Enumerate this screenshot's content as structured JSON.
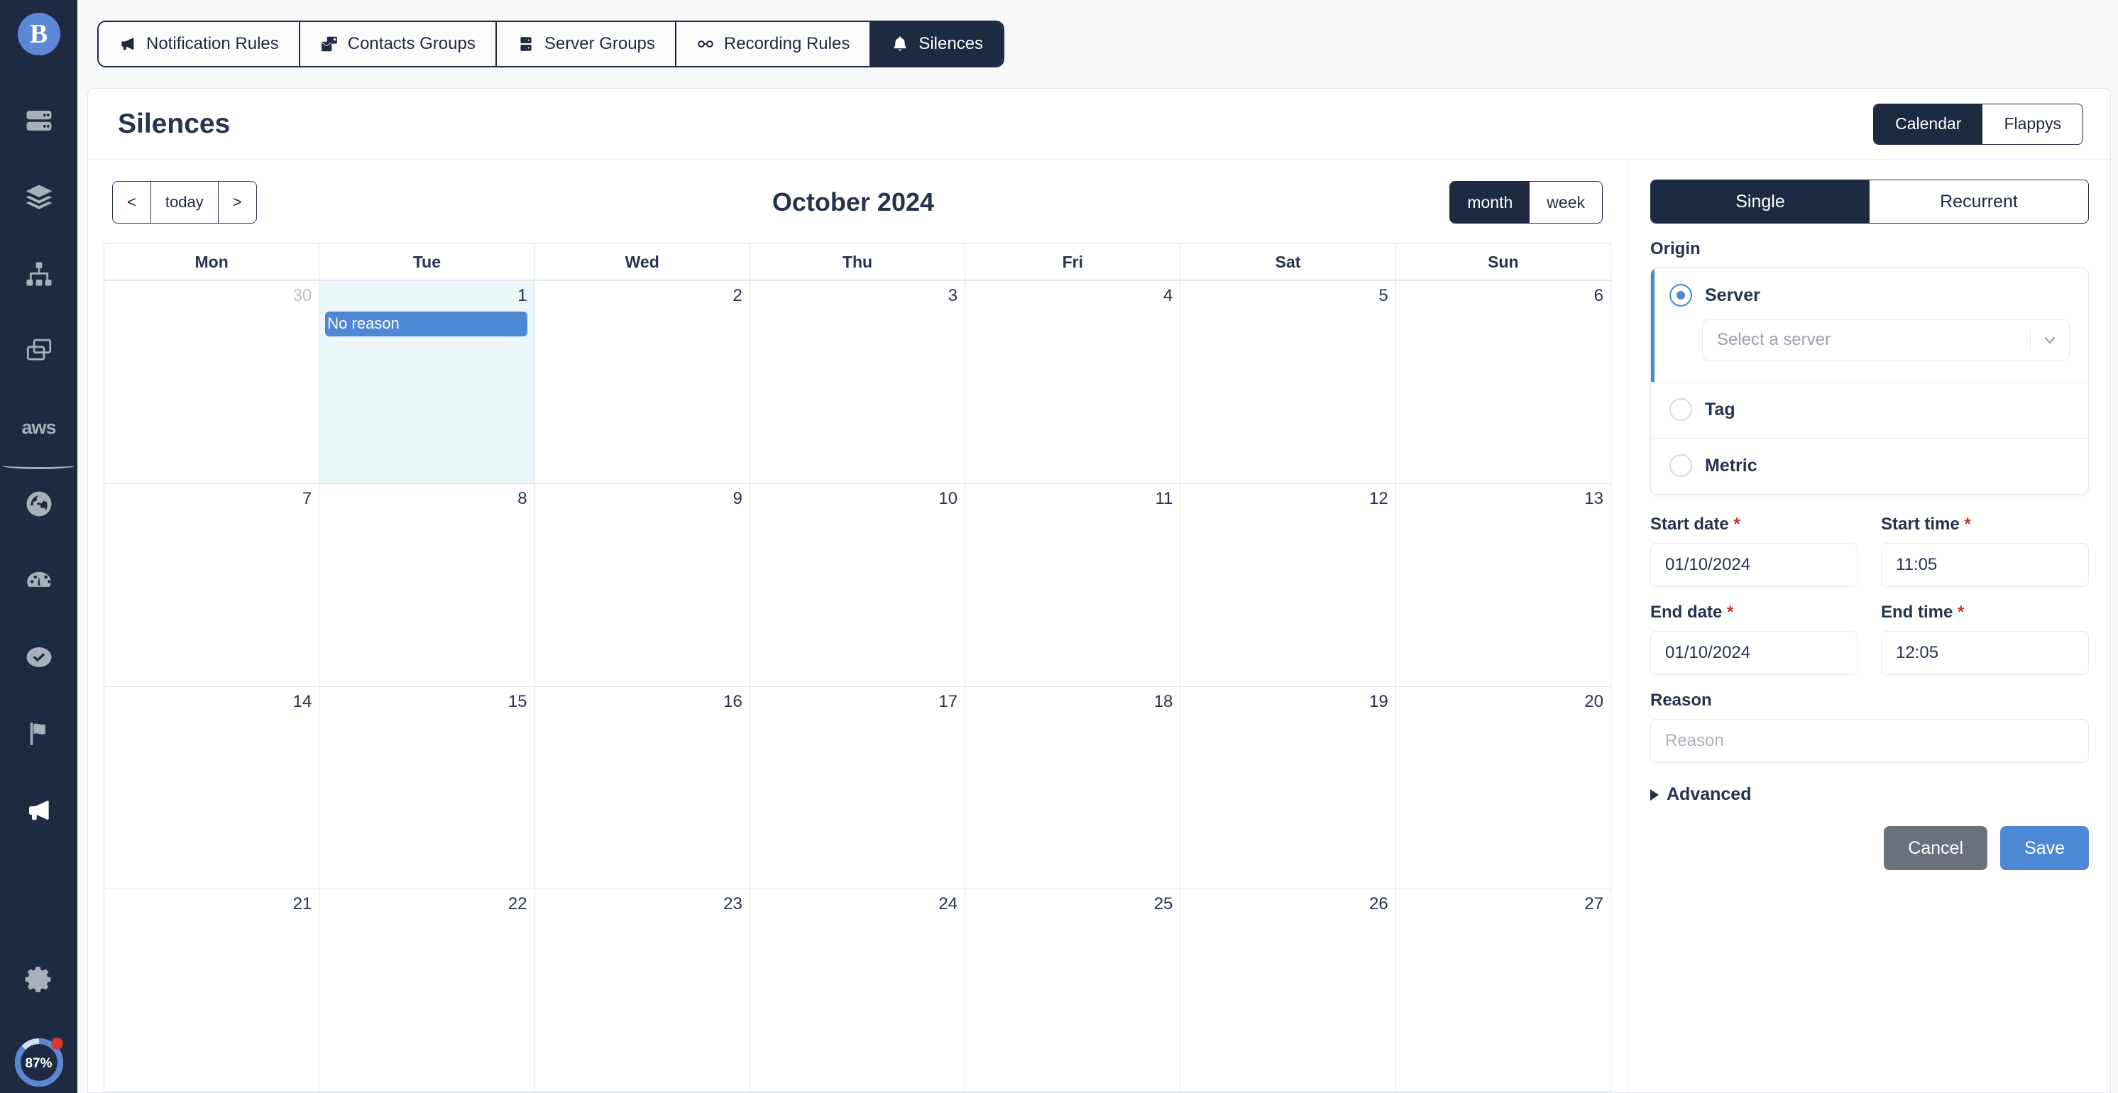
{
  "sidebar": {
    "brand_letter": "B",
    "items": [
      {
        "name": "servers-icon",
        "icon": "servers"
      },
      {
        "name": "layers-icon",
        "icon": "layers"
      },
      {
        "name": "sitemap-icon",
        "icon": "sitemap"
      },
      {
        "name": "clone-icon",
        "icon": "clone"
      },
      {
        "name": "aws-icon",
        "icon": "aws",
        "label": "aws"
      },
      {
        "name": "globe-icon",
        "icon": "globe"
      },
      {
        "name": "gauge-icon",
        "icon": "gauge"
      },
      {
        "name": "check-circle-icon",
        "icon": "check-circle"
      },
      {
        "name": "flag-icon",
        "icon": "flag"
      },
      {
        "name": "megaphone-icon",
        "icon": "megaphone",
        "active": true
      }
    ],
    "settings_icon": "gear",
    "quota_percent": "87%",
    "quota_value": 87
  },
  "tabs": [
    {
      "label": "Notification Rules",
      "icon": "bullhorn",
      "active": false
    },
    {
      "label": "Contacts Groups",
      "icon": "contacts",
      "active": false
    },
    {
      "label": "Server Groups",
      "icon": "server",
      "active": false
    },
    {
      "label": "Recording Rules",
      "icon": "glasses",
      "active": false
    },
    {
      "label": "Silences",
      "icon": "bell",
      "active": true
    }
  ],
  "page": {
    "title": "Silences",
    "view_toggle": [
      {
        "label": "Calendar",
        "active": true
      },
      {
        "label": "Flappys",
        "active": false
      }
    ]
  },
  "calendar": {
    "nav": {
      "prev": "<",
      "today": "today",
      "next": ">"
    },
    "title": "October 2024",
    "view_toggle": [
      {
        "label": "month",
        "active": true
      },
      {
        "label": "week",
        "active": false
      }
    ],
    "day_headers": [
      "Mon",
      "Tue",
      "Wed",
      "Thu",
      "Fri",
      "Sat",
      "Sun"
    ],
    "weeks": [
      [
        {
          "num": "30",
          "other": true
        },
        {
          "num": "1",
          "selected": true,
          "events": [
            "No reason"
          ]
        },
        {
          "num": "2"
        },
        {
          "num": "3"
        },
        {
          "num": "4"
        },
        {
          "num": "5"
        },
        {
          "num": "6"
        }
      ],
      [
        {
          "num": "7"
        },
        {
          "num": "8"
        },
        {
          "num": "9"
        },
        {
          "num": "10"
        },
        {
          "num": "11"
        },
        {
          "num": "12"
        },
        {
          "num": "13"
        }
      ],
      [
        {
          "num": "14"
        },
        {
          "num": "15"
        },
        {
          "num": "16"
        },
        {
          "num": "17"
        },
        {
          "num": "18"
        },
        {
          "num": "19"
        },
        {
          "num": "20"
        }
      ],
      [
        {
          "num": "21"
        },
        {
          "num": "22"
        },
        {
          "num": "23"
        },
        {
          "num": "24"
        },
        {
          "num": "25"
        },
        {
          "num": "26"
        },
        {
          "num": "27"
        }
      ]
    ]
  },
  "form": {
    "mode_toggle": [
      {
        "label": "Single",
        "active": true
      },
      {
        "label": "Recurrent",
        "active": false
      }
    ],
    "origin_label": "Origin",
    "origin_options": [
      {
        "label": "Server",
        "selected": true,
        "select_placeholder": "Select a server"
      },
      {
        "label": "Tag",
        "selected": false
      },
      {
        "label": "Metric",
        "selected": false
      }
    ],
    "start_date": {
      "label": "Start date",
      "required": "*",
      "value": "01/10/2024"
    },
    "start_time": {
      "label": "Start time",
      "required": "*",
      "value": "11:05"
    },
    "end_date": {
      "label": "End date",
      "required": "*",
      "value": "01/10/2024"
    },
    "end_time": {
      "label": "End time",
      "required": "*",
      "value": "12:05"
    },
    "reason": {
      "label": "Reason",
      "placeholder": "Reason",
      "value": ""
    },
    "advanced_label": "Advanced",
    "cancel_label": "Cancel",
    "save_label": "Save"
  },
  "colors": {
    "sidebar_bg": "#1e2a42",
    "accent_blue": "#4e87d4",
    "dark": "#1e2a42",
    "event_blue": "#4e87d4",
    "selected_day": "#eaf6f8",
    "required_red": "#c0392b",
    "cancel_gray": "#6b717c",
    "quota_red": "#d9392f"
  }
}
